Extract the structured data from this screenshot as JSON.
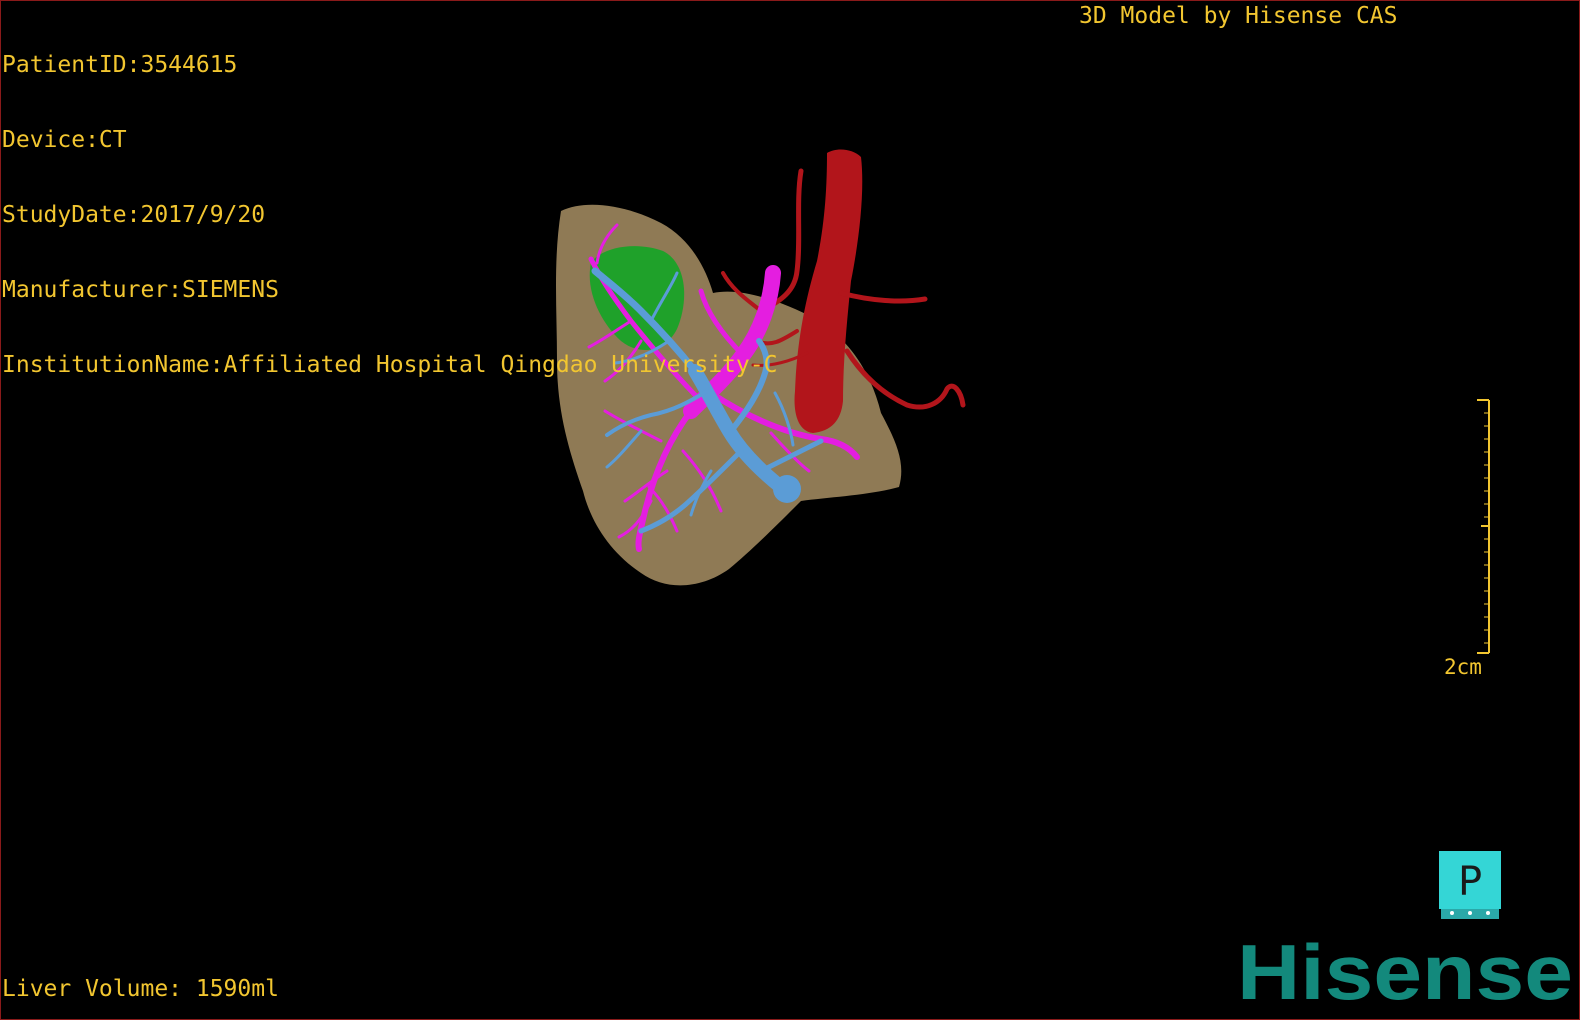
{
  "header": {
    "patient_id": "PatientID:3544615",
    "device": "Device:CT",
    "study_date": "StudyDate:2017/9/20",
    "manufacturer": "Manufacturer:SIEMENS",
    "institution": "InstitutionName:Affiliated Hospital Qingdao University-C",
    "model_credit": "3D Model by Hisense CAS"
  },
  "footer": {
    "liver_volume": "Liver Volume: 1590ml"
  },
  "scale_bar": {
    "label": "2cm"
  },
  "orientation": {
    "label": "P"
  },
  "brand": {
    "name": "Hisense"
  },
  "colors": {
    "overlay_text": "#f2c630",
    "liver": "#8f7a55",
    "gallbladder": "#1fa12a",
    "hepatic_vein": "#e41ee0",
    "portal_vein": "#5b9cd6",
    "artery": "#b2151b",
    "orientation_box": "#34d6d6",
    "brand": "#13897c"
  }
}
